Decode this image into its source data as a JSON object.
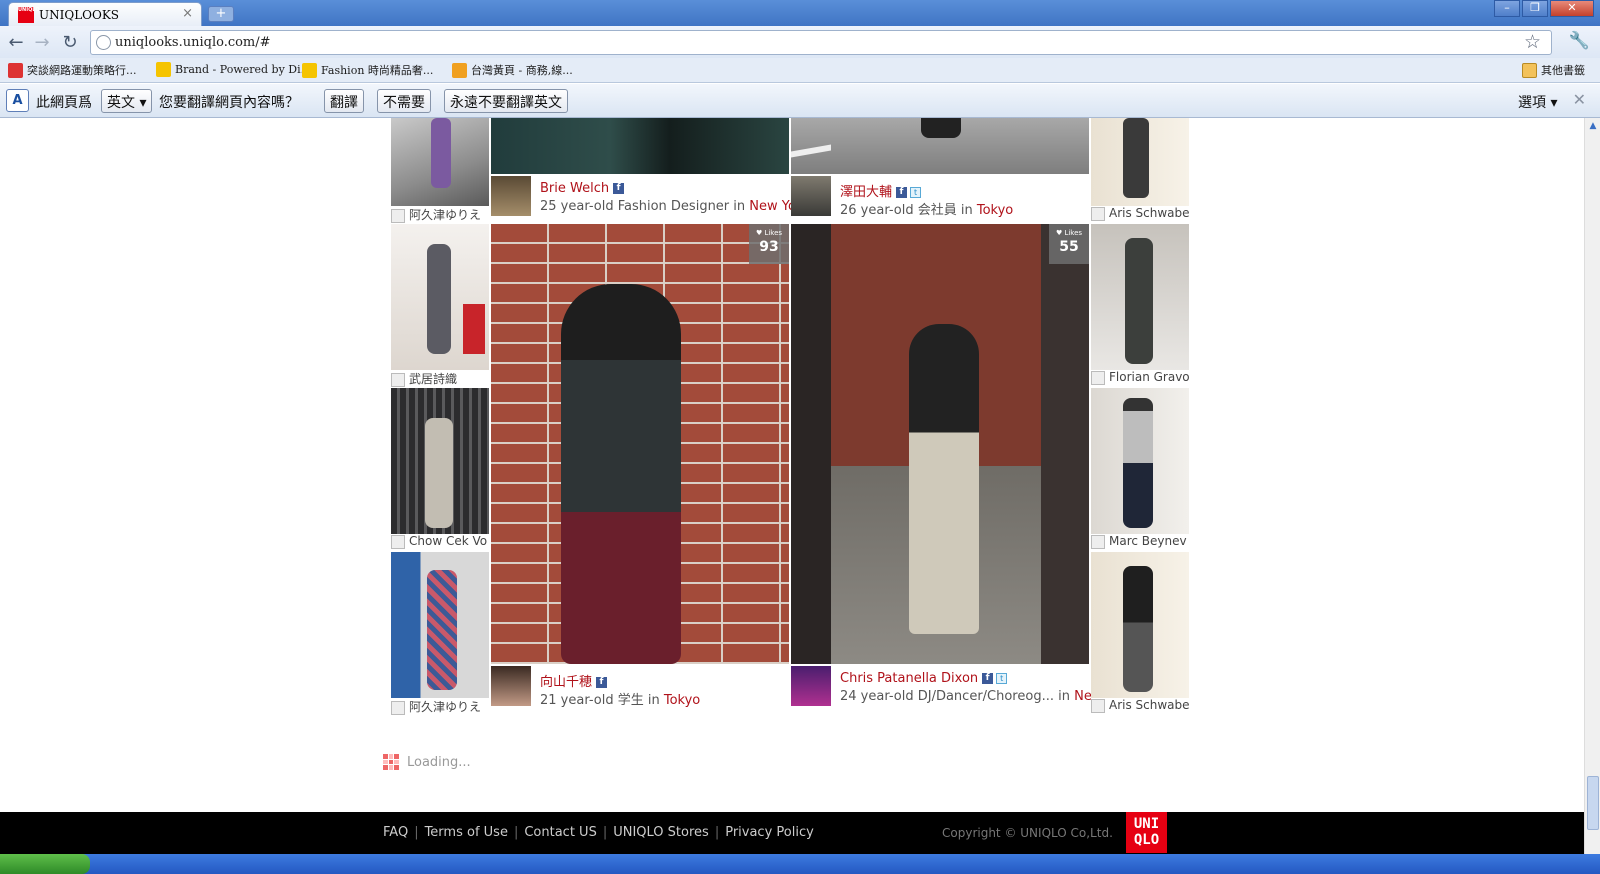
{
  "browser": {
    "tab_title": "UNIQLOOKS",
    "favicon_text": "UNIQLO",
    "url": "uniqlooks.uniqlo.com/#",
    "new_tab": "+",
    "bookmarks": [
      {
        "label": "突談網路運動策略行...",
        "color": "#d33"
      },
      {
        "label": "Brand - Powered by Di...",
        "color": "#f5c400"
      },
      {
        "label": "Fashion 時尚精品奢...",
        "color": "#f5c400"
      },
      {
        "label": "台灣黃頁 - 商務,線...",
        "color": "#f0a020"
      }
    ],
    "other_bookmarks": "其他書籤"
  },
  "translate_bar": {
    "prefix": "此網頁爲",
    "language": "英文",
    "question": "您要翻譯網頁內容嗎？",
    "translate_btn": "翻譯",
    "no_btn": "不需要",
    "never_btn": "永遠不要翻譯英文",
    "options": "選項"
  },
  "feed": {
    "left_column": [
      {
        "name": "阿久津ゆりえ"
      },
      {
        "name": "武居詩織"
      },
      {
        "name": "Chow Cek Vo"
      },
      {
        "name": "阿久津ゆりえ"
      }
    ],
    "right_column": [
      {
        "name": "Aris Schwabe"
      },
      {
        "name": "Florian Gravo"
      },
      {
        "name": "Marc Beynev"
      },
      {
        "name": "Aris Schwabe"
      }
    ],
    "top_cards": [
      {
        "name": "Brie Welch",
        "desc": "25 year-old Fashion Designer in",
        "city": "New York",
        "fb": true,
        "tw": false
      },
      {
        "name": "澤田大輔",
        "desc": "26 year-old 会社員 in",
        "city": "Tokyo",
        "fb": true,
        "tw": true
      }
    ],
    "main_cards": [
      {
        "name": "向山千穂",
        "desc": "21 year-old 学生 in",
        "city": "Tokyo",
        "likes_label": "♥ Likes",
        "likes": "93",
        "fb": true,
        "tw": false
      },
      {
        "name": "Chris Patanella Dixon",
        "desc": "24 year-old DJ/Dancer/Choreog... in",
        "city": "New York",
        "likes_label": "♥ Likes",
        "likes": "55",
        "fb": true,
        "tw": true
      }
    ],
    "loading": "Loading..."
  },
  "footer": {
    "links": [
      "FAQ",
      "Terms of Use",
      "Contact US",
      "UNIQLO Stores",
      "Privacy Policy"
    ],
    "copyright": "Copyright © UNIQLO Co,Ltd.",
    "logo_line1": "UNI",
    "logo_line2": "QLO"
  },
  "colors": {
    "brand_red": "#e60012",
    "link_red": "#b0121a"
  }
}
